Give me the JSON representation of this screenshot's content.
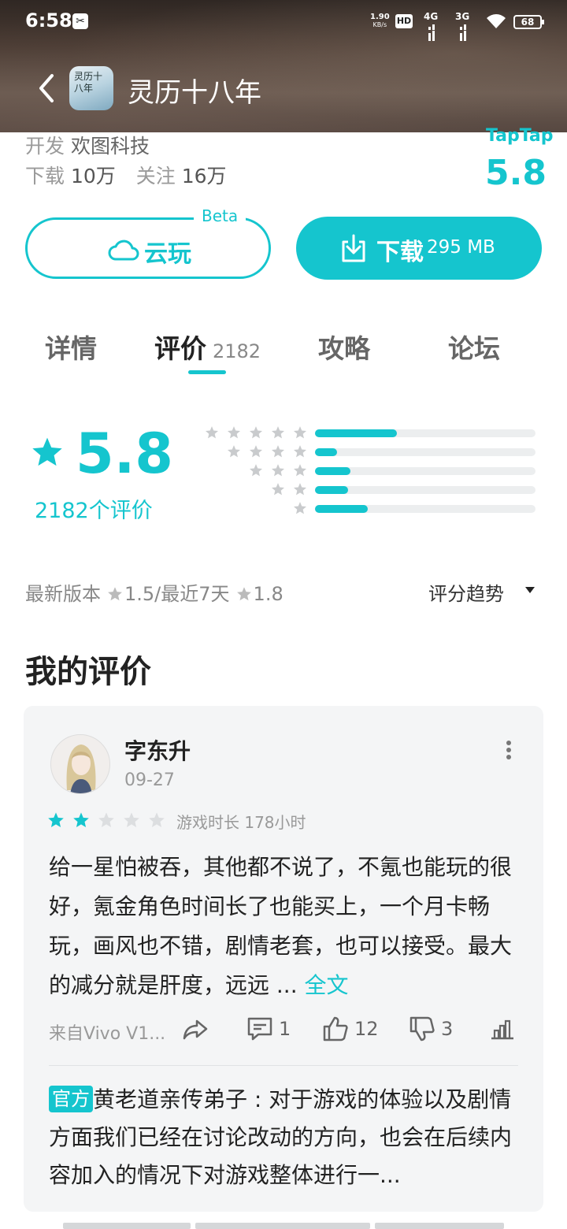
{
  "status_bar": {
    "time": "6:58",
    "net_speed_value": "1.90",
    "net_speed_unit": "KB/s",
    "hd_label": "HD",
    "sim1_label": "4G",
    "sim2_label": "3G",
    "battery": "68"
  },
  "header": {
    "title": "灵历十八年",
    "icon_text": "灵历十八年"
  },
  "info": {
    "developer_label": "开发",
    "developer": "欢图科技",
    "downloads_label": "下载",
    "downloads": "10万",
    "follows_label": "关注",
    "follows": "16万",
    "brand": "TapTap",
    "score": "5.8"
  },
  "buttons": {
    "cloud_play": "云玩",
    "beta": "Beta",
    "download": "下载",
    "download_size": "295 MB"
  },
  "tabs": [
    {
      "label": "详情"
    },
    {
      "label": "评价",
      "count": "2182"
    },
    {
      "label": "攻略"
    },
    {
      "label": "论坛"
    }
  ],
  "rating": {
    "score": "5.8",
    "count_label": "2182个评价",
    "distribution": [
      {
        "stars": 5,
        "fraction": 0.37
      },
      {
        "stars": 4,
        "fraction": 0.1
      },
      {
        "stars": 3,
        "fraction": 0.16
      },
      {
        "stars": 2,
        "fraction": 0.15
      },
      {
        "stars": 1,
        "fraction": 0.24
      }
    ]
  },
  "versions": {
    "latest_label": "最新版本",
    "latest_score": "1.5",
    "separator": "/",
    "recent_label": "最近7天",
    "recent_score": "1.8",
    "trend_label": "评分趋势"
  },
  "my_review": {
    "section_title": "我的评价",
    "username": "字东升",
    "date": "09-27",
    "stars": 2,
    "playtime": "游戏时长 178小时",
    "text": "给一星怕被吞，其他都不说了，不氪也能玩的很好，氪金角色时间长了也能买上，一个月卡畅玩，画风也不错，剧情老套，也可以接受。最大的减分就是肝度，远远 ...",
    "full_text_link": "全文",
    "device": "来自Vivo V1...",
    "comments": "1",
    "likes": "12",
    "dislikes": "3",
    "official_tag": "官方",
    "official_reply": "黄老道亲传弟子 : 对于游戏的体验以及剧情方面我们已经在讨论改动的方向，也会在后续内容加入的情况下对游戏整体进行一..."
  },
  "colors": {
    "accent": "#15c5ce",
    "text": "#222222",
    "muted": "#999999",
    "card_bg": "#f4f5f6"
  }
}
